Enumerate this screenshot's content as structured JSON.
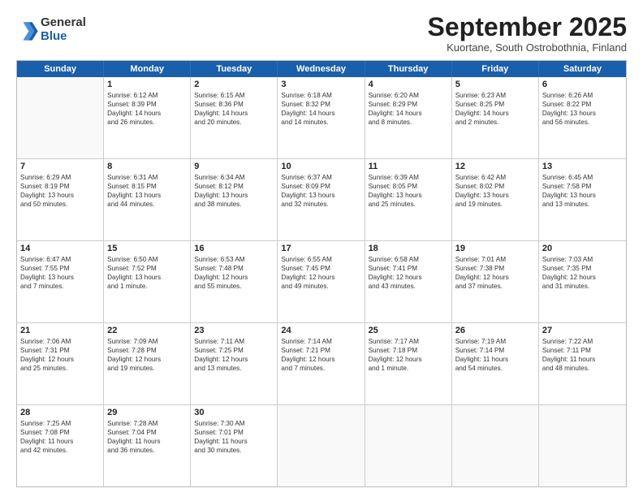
{
  "logo": {
    "general": "General",
    "blue": "Blue"
  },
  "title": "September 2025",
  "location": "Kuortane, South Ostrobothnia, Finland",
  "weekdays": [
    "Sunday",
    "Monday",
    "Tuesday",
    "Wednesday",
    "Thursday",
    "Friday",
    "Saturday"
  ],
  "rows": [
    [
      {
        "day": "",
        "info": ""
      },
      {
        "day": "1",
        "info": "Sunrise: 6:12 AM\nSunset: 8:39 PM\nDaylight: 14 hours\nand 26 minutes."
      },
      {
        "day": "2",
        "info": "Sunrise: 6:15 AM\nSunset: 8:36 PM\nDaylight: 14 hours\nand 20 minutes."
      },
      {
        "day": "3",
        "info": "Sunrise: 6:18 AM\nSunset: 8:32 PM\nDaylight: 14 hours\nand 14 minutes."
      },
      {
        "day": "4",
        "info": "Sunrise: 6:20 AM\nSunset: 8:29 PM\nDaylight: 14 hours\nand 8 minutes."
      },
      {
        "day": "5",
        "info": "Sunrise: 6:23 AM\nSunset: 8:25 PM\nDaylight: 14 hours\nand 2 minutes."
      },
      {
        "day": "6",
        "info": "Sunrise: 6:26 AM\nSunset: 8:22 PM\nDaylight: 13 hours\nand 56 minutes."
      }
    ],
    [
      {
        "day": "7",
        "info": "Sunrise: 6:29 AM\nSunset: 8:19 PM\nDaylight: 13 hours\nand 50 minutes."
      },
      {
        "day": "8",
        "info": "Sunrise: 6:31 AM\nSunset: 8:15 PM\nDaylight: 13 hours\nand 44 minutes."
      },
      {
        "day": "9",
        "info": "Sunrise: 6:34 AM\nSunset: 8:12 PM\nDaylight: 13 hours\nand 38 minutes."
      },
      {
        "day": "10",
        "info": "Sunrise: 6:37 AM\nSunset: 8:09 PM\nDaylight: 13 hours\nand 32 minutes."
      },
      {
        "day": "11",
        "info": "Sunrise: 6:39 AM\nSunset: 8:05 PM\nDaylight: 13 hours\nand 25 minutes."
      },
      {
        "day": "12",
        "info": "Sunrise: 6:42 AM\nSunset: 8:02 PM\nDaylight: 13 hours\nand 19 minutes."
      },
      {
        "day": "13",
        "info": "Sunrise: 6:45 AM\nSunset: 7:58 PM\nDaylight: 13 hours\nand 13 minutes."
      }
    ],
    [
      {
        "day": "14",
        "info": "Sunrise: 6:47 AM\nSunset: 7:55 PM\nDaylight: 13 hours\nand 7 minutes."
      },
      {
        "day": "15",
        "info": "Sunrise: 6:50 AM\nSunset: 7:52 PM\nDaylight: 13 hours\nand 1 minute."
      },
      {
        "day": "16",
        "info": "Sunrise: 6:53 AM\nSunset: 7:48 PM\nDaylight: 12 hours\nand 55 minutes."
      },
      {
        "day": "17",
        "info": "Sunrise: 6:55 AM\nSunset: 7:45 PM\nDaylight: 12 hours\nand 49 minutes."
      },
      {
        "day": "18",
        "info": "Sunrise: 6:58 AM\nSunset: 7:41 PM\nDaylight: 12 hours\nand 43 minutes."
      },
      {
        "day": "19",
        "info": "Sunrise: 7:01 AM\nSunset: 7:38 PM\nDaylight: 12 hours\nand 37 minutes."
      },
      {
        "day": "20",
        "info": "Sunrise: 7:03 AM\nSunset: 7:35 PM\nDaylight: 12 hours\nand 31 minutes."
      }
    ],
    [
      {
        "day": "21",
        "info": "Sunrise: 7:06 AM\nSunset: 7:31 PM\nDaylight: 12 hours\nand 25 minutes."
      },
      {
        "day": "22",
        "info": "Sunrise: 7:09 AM\nSunset: 7:28 PM\nDaylight: 12 hours\nand 19 minutes."
      },
      {
        "day": "23",
        "info": "Sunrise: 7:11 AM\nSunset: 7:25 PM\nDaylight: 12 hours\nand 13 minutes."
      },
      {
        "day": "24",
        "info": "Sunrise: 7:14 AM\nSunset: 7:21 PM\nDaylight: 12 hours\nand 7 minutes."
      },
      {
        "day": "25",
        "info": "Sunrise: 7:17 AM\nSunset: 7:18 PM\nDaylight: 12 hours\nand 1 minute."
      },
      {
        "day": "26",
        "info": "Sunrise: 7:19 AM\nSunset: 7:14 PM\nDaylight: 11 hours\nand 54 minutes."
      },
      {
        "day": "27",
        "info": "Sunrise: 7:22 AM\nSunset: 7:11 PM\nDaylight: 11 hours\nand 48 minutes."
      }
    ],
    [
      {
        "day": "28",
        "info": "Sunrise: 7:25 AM\nSunset: 7:08 PM\nDaylight: 11 hours\nand 42 minutes."
      },
      {
        "day": "29",
        "info": "Sunrise: 7:28 AM\nSunset: 7:04 PM\nDaylight: 11 hours\nand 36 minutes."
      },
      {
        "day": "30",
        "info": "Sunrise: 7:30 AM\nSunset: 7:01 PM\nDaylight: 11 hours\nand 30 minutes."
      },
      {
        "day": "",
        "info": ""
      },
      {
        "day": "",
        "info": ""
      },
      {
        "day": "",
        "info": ""
      },
      {
        "day": "",
        "info": ""
      }
    ]
  ]
}
